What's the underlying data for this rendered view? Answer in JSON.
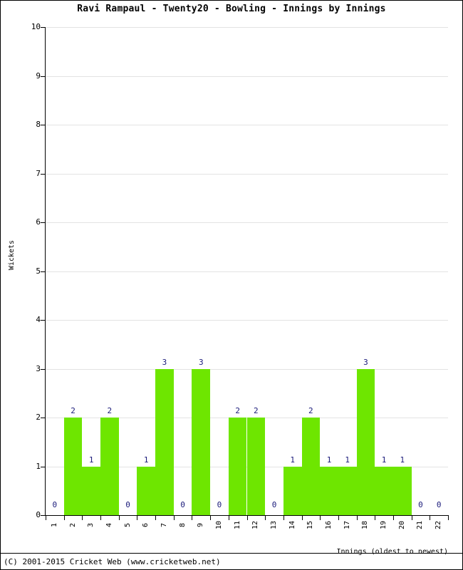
{
  "chart_data": {
    "type": "bar",
    "title": "Ravi Rampaul - Twenty20 - Bowling - Innings by Innings",
    "xlabel": "Innings (oldest to newest)",
    "ylabel": "Wickets",
    "categories": [
      "1",
      "2",
      "3",
      "4",
      "5",
      "6",
      "7",
      "8",
      "9",
      "10",
      "11",
      "12",
      "13",
      "14",
      "15",
      "16",
      "17",
      "18",
      "19",
      "20",
      "21",
      "22"
    ],
    "values": [
      0,
      2,
      1,
      2,
      0,
      1,
      3,
      0,
      3,
      0,
      2,
      2,
      0,
      1,
      2,
      1,
      1,
      3,
      1,
      1,
      0,
      0
    ],
    "data_labels": [
      "0",
      "2",
      "1",
      "2",
      "0",
      "1",
      "3",
      "0",
      "3",
      "0",
      "2",
      "2",
      "0",
      "1",
      "2",
      "1",
      "1",
      "3",
      "1",
      "1",
      "0",
      "0"
    ],
    "ylim": [
      0,
      10
    ],
    "y_ticks": [
      "0",
      "1",
      "2",
      "3",
      "4",
      "5",
      "6",
      "7",
      "8",
      "9",
      "10"
    ],
    "grid": true,
    "legend": "none",
    "bar_color": "#6EE600",
    "label_color": "#1A1A7A",
    "grid_color": "#E3E3E3",
    "axis_color": "#000000"
  },
  "footer": {
    "copyright": "(C) 2001-2015 Cricket Web (www.cricketweb.net)"
  }
}
